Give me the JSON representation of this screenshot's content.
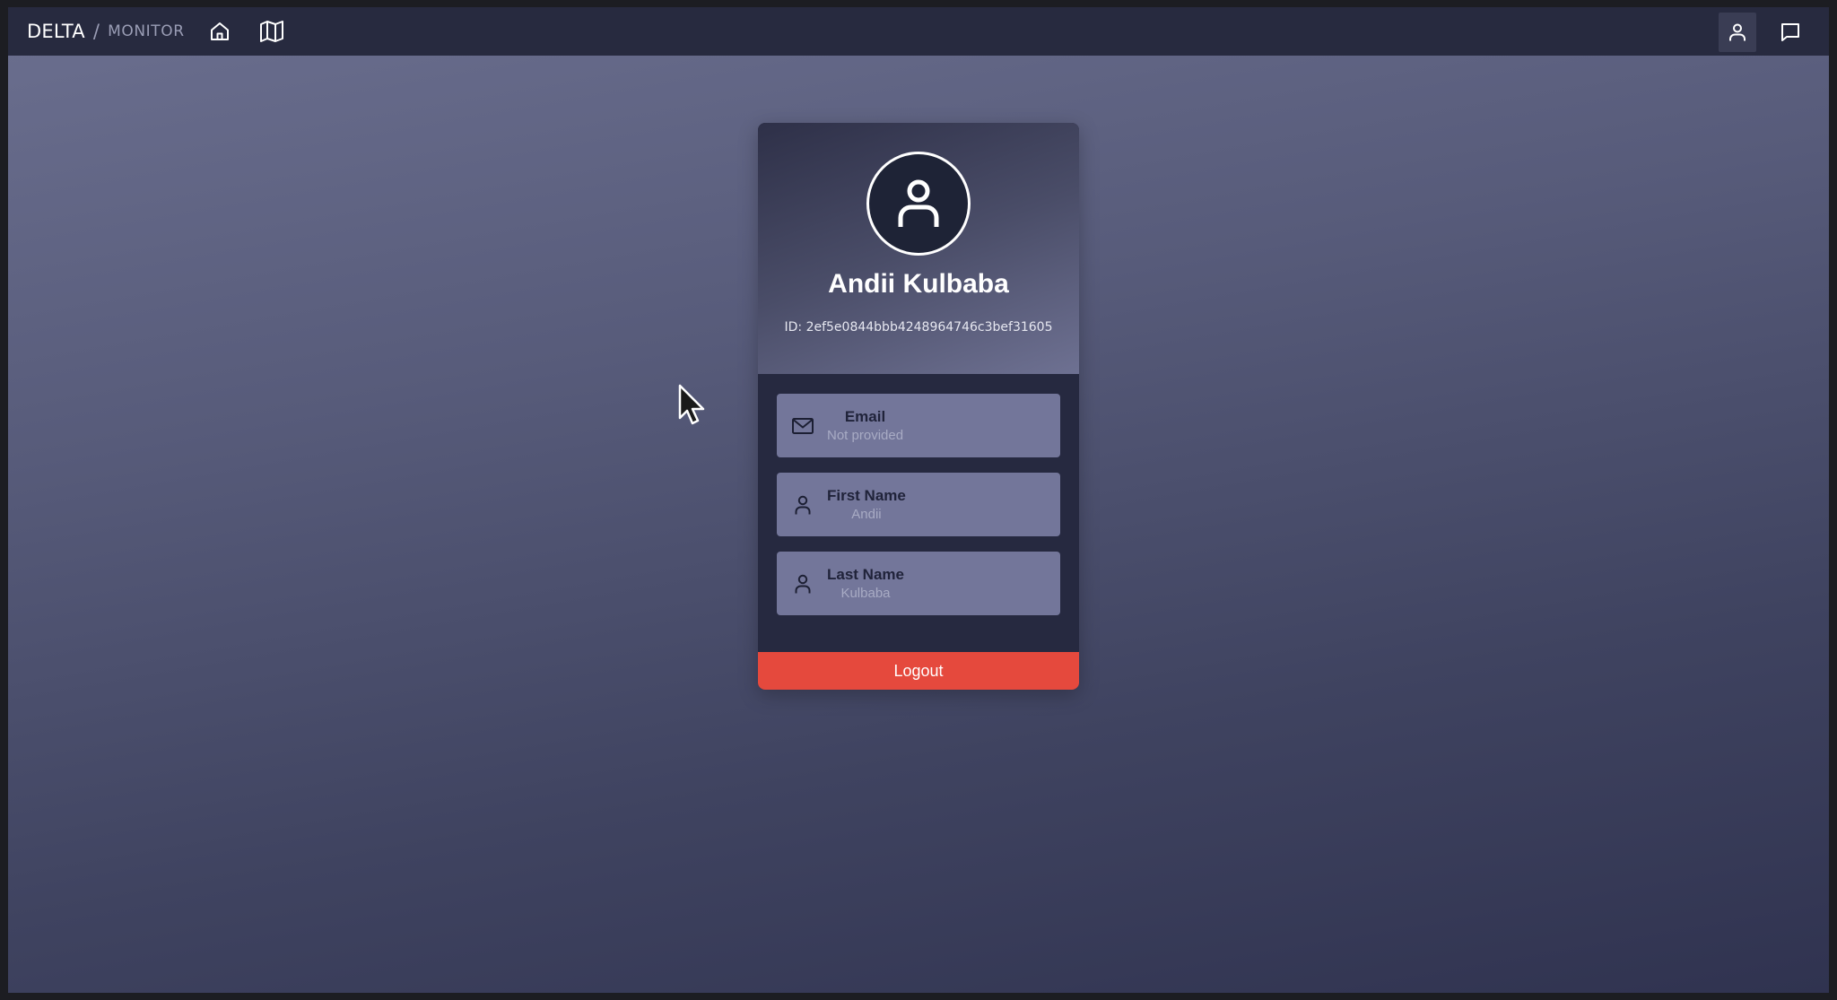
{
  "header": {
    "brand": "DELTA",
    "separator": "/",
    "section": "MONITOR",
    "icons": {
      "home": "home-icon",
      "map": "map-icon",
      "profile": "user-icon",
      "chat": "chat-icon"
    }
  },
  "profile": {
    "name": "Andii Kulbaba",
    "id_text": "ID: 2ef5e0844bbb4248964746c3bef31605",
    "fields": [
      {
        "label": "Email",
        "value": "Not provided",
        "icon": "mail-icon"
      },
      {
        "label": "First Name",
        "value": "Andii",
        "icon": "user-icon"
      },
      {
        "label": "Last Name",
        "value": "Kulbaba",
        "icon": "user-icon"
      }
    ],
    "logout_label": "Logout"
  },
  "colors": {
    "topbar": "#272a3f",
    "card_body": "#262940",
    "field_bg": "#73769a",
    "logout": "#e5493d"
  }
}
